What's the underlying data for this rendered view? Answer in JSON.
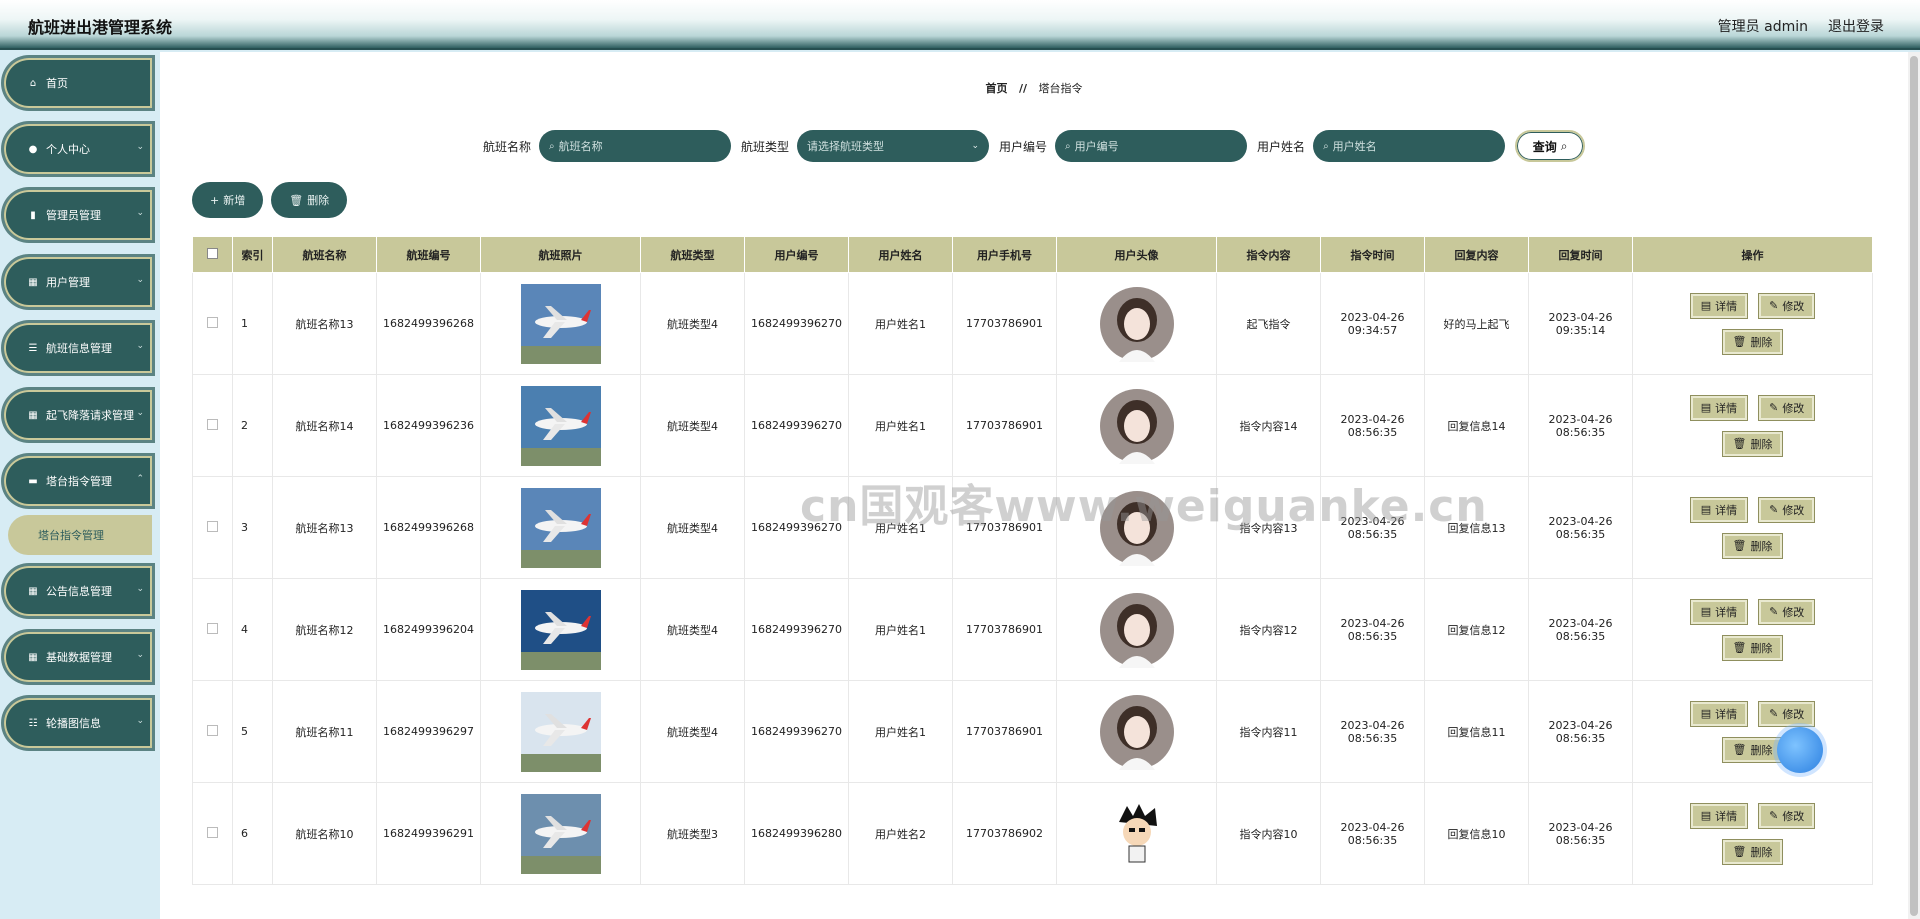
{
  "app": {
    "title": "航班进出港管理系统"
  },
  "header": {
    "user_label": "管理员 admin",
    "logout_label": "退出登录"
  },
  "sidebar": {
    "items": [
      {
        "label": "首页"
      },
      {
        "label": "个人中心"
      },
      {
        "label": "管理员管理"
      },
      {
        "label": "用户管理"
      },
      {
        "label": "航班信息管理"
      },
      {
        "label": "起飞降落请求管理"
      },
      {
        "label": "塔台指令管理"
      },
      {
        "label": "公告信息管理"
      },
      {
        "label": "基础数据管理"
      },
      {
        "label": "轮播图信息"
      }
    ],
    "active_sub": "塔台指令管理"
  },
  "breadcrumb": {
    "home": "首页",
    "sep": "//",
    "current": "塔台指令"
  },
  "search": {
    "flight_name_label": "航班名称",
    "flight_name_placeholder": "航班名称",
    "flight_type_label": "航班类型",
    "flight_type_placeholder": "请选择航班类型",
    "user_id_label": "用户编号",
    "user_id_placeholder": "用户编号",
    "user_name_label": "用户姓名",
    "user_name_placeholder": "用户姓名",
    "query_label": "查询"
  },
  "actions": {
    "add_label": "新增",
    "delete_label": "删除"
  },
  "table": {
    "headers": [
      "索引",
      "航班名称",
      "航班编号",
      "航班照片",
      "航班类型",
      "用户编号",
      "用户姓名",
      "用户手机号",
      "用户头像",
      "指令内容",
      "指令时间",
      "回复内容",
      "回复时间",
      "操作"
    ],
    "op_labels": {
      "detail": "详情",
      "edit": "修改",
      "delete": "删除"
    },
    "rows": [
      {
        "index": "1",
        "name": "航班名称13",
        "code": "1682499396268",
        "type": "航班类型4",
        "user_id": "1682499396270",
        "user_name": "用户姓名1",
        "phone": "17703786901",
        "command": "起飞指令",
        "cmd_time": "2023-04-26 09:34:57",
        "reply": "好的马上起飞",
        "reply_time": "2023-04-26 09:35:14"
      },
      {
        "index": "2",
        "name": "航班名称14",
        "code": "1682499396236",
        "type": "航班类型4",
        "user_id": "1682499396270",
        "user_name": "用户姓名1",
        "phone": "17703786901",
        "command": "指令内容14",
        "cmd_time": "2023-04-26 08:56:35",
        "reply": "回复信息14",
        "reply_time": "2023-04-26 08:56:35"
      },
      {
        "index": "3",
        "name": "航班名称13",
        "code": "1682499396268",
        "type": "航班类型4",
        "user_id": "1682499396270",
        "user_name": "用户姓名1",
        "phone": "17703786901",
        "command": "指令内容13",
        "cmd_time": "2023-04-26 08:56:35",
        "reply": "回复信息13",
        "reply_time": "2023-04-26 08:56:35"
      },
      {
        "index": "4",
        "name": "航班名称12",
        "code": "1682499396204",
        "type": "航班类型4",
        "user_id": "1682499396270",
        "user_name": "用户姓名1",
        "phone": "17703786901",
        "command": "指令内容12",
        "cmd_time": "2023-04-26 08:56:35",
        "reply": "回复信息12",
        "reply_time": "2023-04-26 08:56:35"
      },
      {
        "index": "5",
        "name": "航班名称11",
        "code": "1682499396297",
        "type": "航班类型4",
        "user_id": "1682499396270",
        "user_name": "用户姓名1",
        "phone": "17703786901",
        "command": "指令内容11",
        "cmd_time": "2023-04-26 08:56:35",
        "reply": "回复信息11",
        "reply_time": "2023-04-26 08:56:35"
      },
      {
        "index": "6",
        "name": "航班名称10",
        "code": "1682499396291",
        "type": "航班类型3",
        "user_id": "1682499396280",
        "user_name": "用户姓名2",
        "phone": "17703786902",
        "command": "指令内容10",
        "cmd_time": "2023-04-26 08:56:35",
        "reply": "回复信息10",
        "reply_time": "2023-04-26 08:56:35"
      }
    ]
  },
  "watermark": "cn国观客www.weiguanke.cn"
}
